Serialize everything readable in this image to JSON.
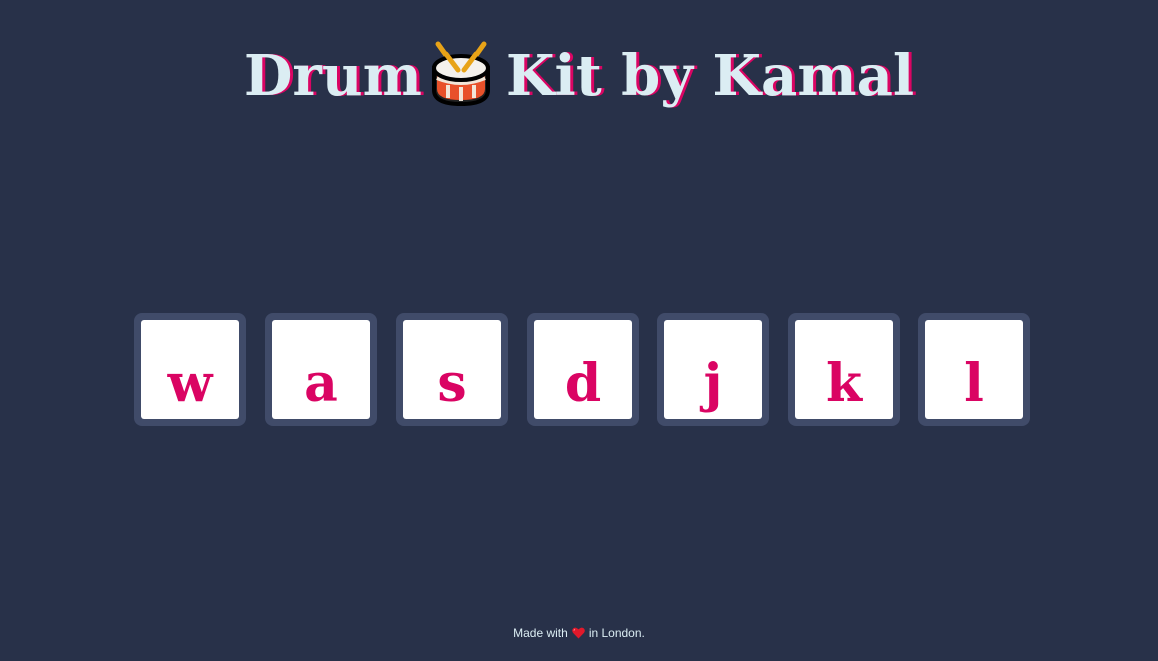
{
  "header": {
    "title_part1": "Drum",
    "title_icon": "drum-icon",
    "title_part2": "Kit by Kamal"
  },
  "keys": [
    {
      "letter": "w"
    },
    {
      "letter": "a"
    },
    {
      "letter": "s"
    },
    {
      "letter": "d"
    },
    {
      "letter": "j"
    },
    {
      "letter": "k"
    },
    {
      "letter": "l"
    }
  ],
  "footer": {
    "made_with": "Made with",
    "heart_icon": "heart-icon",
    "location": "in London."
  },
  "colors": {
    "background": "#283149",
    "title_text": "#DBEDF3",
    "accent": "#DA0463",
    "key_border": "#404B69",
    "key_face": "#FFFFFF"
  }
}
